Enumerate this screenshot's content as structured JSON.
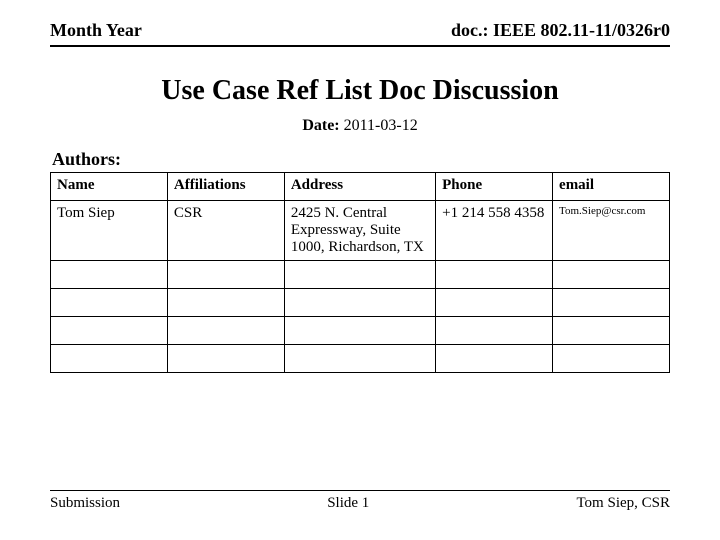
{
  "header": {
    "left": "Month Year",
    "right": "doc.: IEEE 802.11-11/0326r0"
  },
  "title": "Use Case Ref List Doc Discussion",
  "date_label": "Date:",
  "date_value": "2011-03-12",
  "authors_label": "Authors:",
  "table": {
    "headers": [
      "Name",
      "Affiliations",
      "Address",
      "Phone",
      "email"
    ],
    "rows": [
      {
        "name": "Tom Siep",
        "affil": "CSR",
        "address": "2425 N. Central Expressway, Suite 1000, Richardson, TX",
        "phone": "+1 214 558 4358",
        "email": "Tom.Siep@csr.com"
      },
      {
        "name": "",
        "affil": "",
        "address": "",
        "phone": "",
        "email": ""
      },
      {
        "name": "",
        "affil": "",
        "address": "",
        "phone": "",
        "email": ""
      },
      {
        "name": "",
        "affil": "",
        "address": "",
        "phone": "",
        "email": ""
      },
      {
        "name": "",
        "affil": "",
        "address": "",
        "phone": "",
        "email": ""
      }
    ]
  },
  "footer": {
    "left": "Submission",
    "center": "Slide 1",
    "right": "Tom Siep, CSR"
  }
}
